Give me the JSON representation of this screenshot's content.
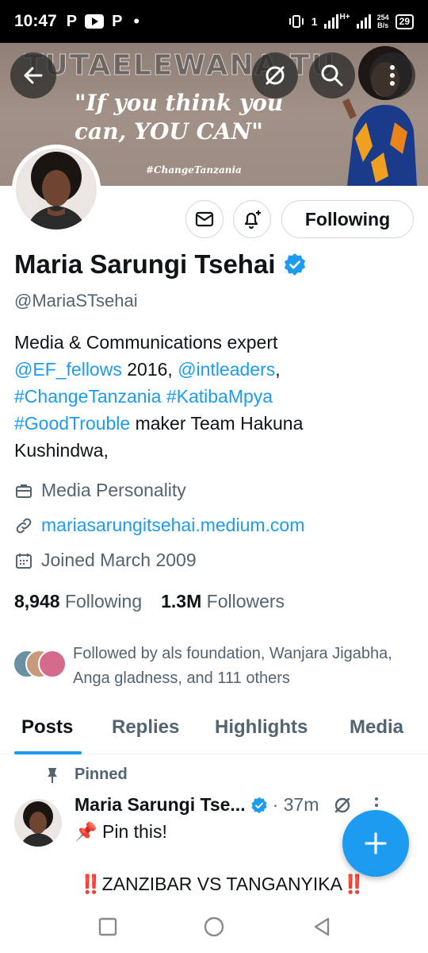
{
  "status_bar": {
    "time": "10:47",
    "app_p1": "P",
    "app_p2": "P",
    "dot": "•",
    "net_type": "H+",
    "net_type2": "1",
    "speed_value": "254",
    "speed_unit": "B/s",
    "battery": "29"
  },
  "banner": {
    "wordmark": "TUTAELEWANA TU",
    "quote_line1": "\"If you think you",
    "quote_line2": "can, YOU CAN\"",
    "hashtag": "#ChangeTanzania"
  },
  "profile": {
    "name": "Maria Sarungi Tsehai",
    "handle": "@MariaSTsehai",
    "following_button": "Following",
    "bio": {
      "line1": "Media & Communications expert",
      "link1": "@EF_fellows",
      "text2": " 2016, ",
      "link2": "@intleaders",
      "text3": ",",
      "tag1": "#ChangeTanzania",
      "space": " ",
      "tag2": "#KatibaMpya",
      "tag3": "#GoodTrouble",
      "text4": " maker Team Hakuna",
      "line5": "Kushindwa,"
    },
    "category": "Media Personality",
    "website": "mariasarungitsehai.medium.com",
    "joined": "Joined March 2009",
    "following_count": "8,948",
    "following_label": "Following",
    "followers_count": "1.3M",
    "followers_label": "Followers",
    "followed_by": "Followed by als foundation, Wanjara Jigabha, Anga gladness, and 111 others"
  },
  "tabs": [
    {
      "label": "Posts"
    },
    {
      "label": "Replies"
    },
    {
      "label": "Highlights"
    },
    {
      "label": "Media"
    }
  ],
  "tweet": {
    "pinned_label": "Pinned",
    "author": "Maria Sarungi Tse...",
    "time": "· 37m",
    "line1_emoji": "📌",
    "line1_text": " Pin this!",
    "line2_bang": "‼️",
    "line2_text": "ZANZIBAR VS TANGANYIKA"
  },
  "colors": {
    "accent": "#1d9bf0",
    "text_primary": "#0f1419",
    "text_secondary": "#536471",
    "border": "#cfd9de"
  }
}
